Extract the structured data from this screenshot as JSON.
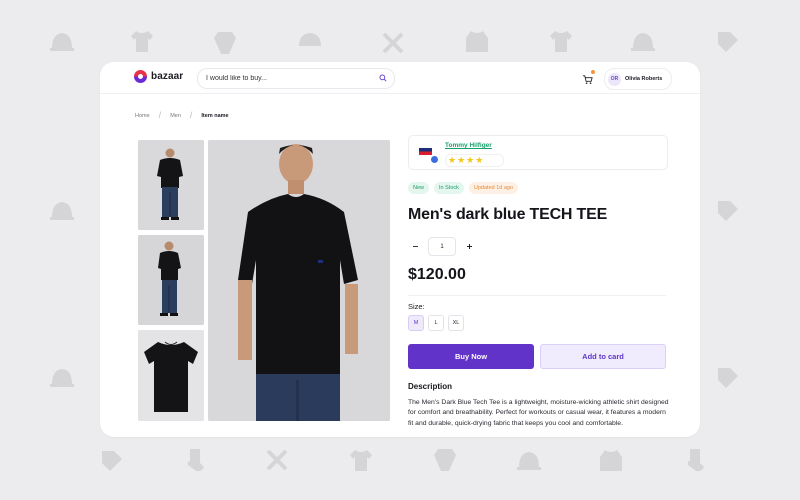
{
  "header": {
    "logo_text": "bazaar",
    "search": {
      "placeholder": "I would like to buy..."
    },
    "user": {
      "initials": "OR",
      "name": "Olivia Roberts"
    }
  },
  "breadcrumb": [
    "Home",
    "Men",
    "Item name"
  ],
  "product": {
    "brand": "Tommy Hilfiger",
    "rating": 4,
    "rating_max": 5,
    "badges": [
      "New",
      "In Stock",
      "Updated 1d ago"
    ],
    "title": "Men's dark blue TECH TEE",
    "quantity": "1",
    "price": "$120.00",
    "size_label": "Size:",
    "sizes": [
      "M",
      "L",
      "XL"
    ],
    "selected_size": "M",
    "buy_label": "Buy Now",
    "add_label": "Add to card",
    "description_title": "Description",
    "description": "The Men's Dark Blue Tech Tee is a lightweight, moisture-wicking athletic shirt designed for comfort and breathability. Perfect for workouts or casual wear, it features a modern fit and durable, quick-drying fabric that keeps you cool and comfortable."
  },
  "colors": {
    "accent": "#6233c9",
    "accent_soft": "#f1ecfd",
    "brand_link": "#16a06a",
    "star": "#f5c518",
    "badge_green_bg": "#e3f7ef",
    "badge_orange_bg": "#fdf1e6"
  },
  "icons": [
    "search-icon",
    "cart-icon",
    "verified-icon",
    "star-icon",
    "minus-icon",
    "plus-icon"
  ]
}
